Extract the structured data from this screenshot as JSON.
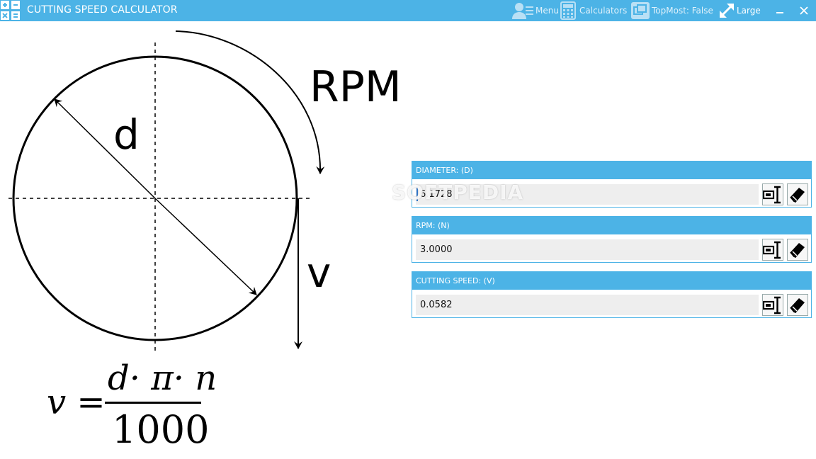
{
  "app": {
    "title": "CUTTING SPEED CALCULATOR"
  },
  "toolbar": {
    "menu_label": "Menu",
    "calculators_label": "Calculators",
    "topmost_label": "TopMost: False",
    "size_label": "Large"
  },
  "diagram": {
    "rpm_label": "RPM",
    "d_label": "d",
    "v_label": "v",
    "formula_lhs": "v =",
    "formula_numerator": "d· π· n",
    "formula_denominator": "1000"
  },
  "fields": [
    {
      "label": "DIAMETER: (D)",
      "value": "6.1728"
    },
    {
      "label": "RPM: (N)",
      "value": "3.0000"
    },
    {
      "label": "CUTTING SPEED: (V)",
      "value": "0.0582"
    }
  ],
  "watermark": "SOFTPEDIA",
  "colors": {
    "accent": "#4cb3e6",
    "input_bg": "#eeeeee"
  }
}
